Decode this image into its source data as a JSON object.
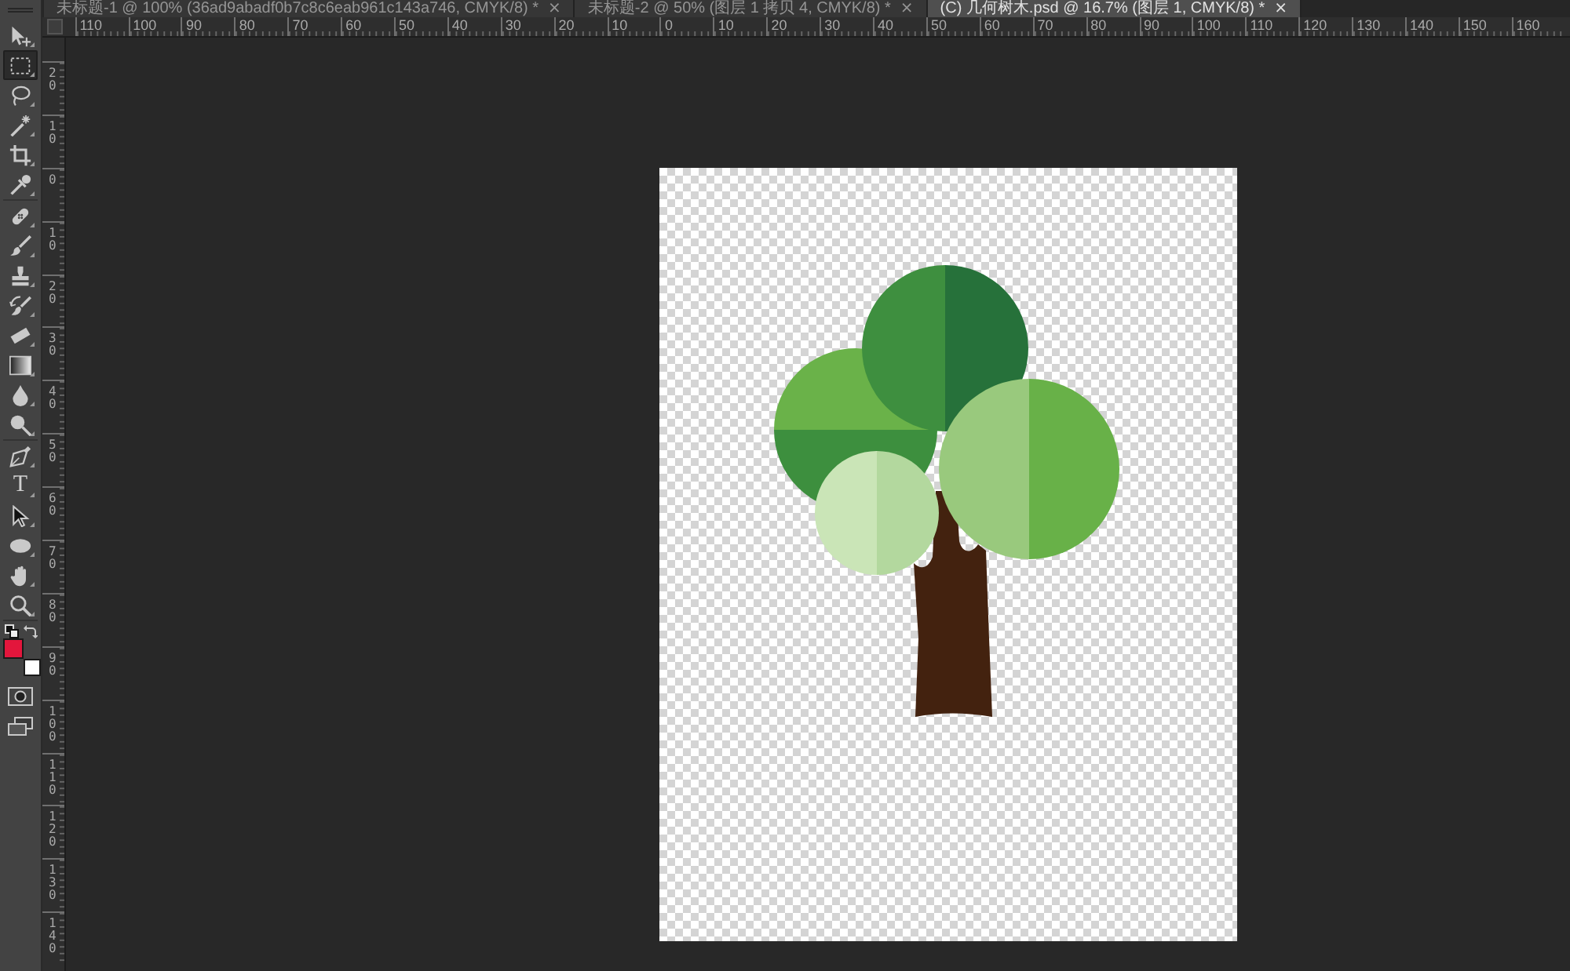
{
  "tabs": [
    {
      "label": "未标题-1 @ 100% (36ad9abadf0b7c8c6eab961c143a746, CMYK/8) *",
      "close": "×",
      "selected": false
    },
    {
      "label": "未标题-2 @ 50% (图层 1 拷贝 4, CMYK/8) *",
      "close": "×",
      "selected": false
    },
    {
      "label": "(C) 几何树木.psd @ 16.7% (图层 1, CMYK/8) *",
      "close": "×",
      "selected": true
    }
  ],
  "rulers": {
    "horizontal": [
      "110",
      "100",
      "90",
      "80",
      "70",
      "60",
      "50",
      "40",
      "30",
      "20",
      "10",
      "0",
      "10",
      "20",
      "30",
      "40",
      "50",
      "60",
      "70",
      "80",
      "90",
      "100",
      "110",
      "120",
      "130",
      "140",
      "150",
      "160"
    ],
    "vertical": [
      "20",
      "10",
      "0",
      "10",
      "20",
      "30",
      "40",
      "50",
      "60",
      "70",
      "80",
      "90",
      "100",
      "110",
      "120",
      "130",
      "140"
    ]
  },
  "tool_groups": [
    {
      "tools": [
        {
          "kind": "move",
          "selected": false
        },
        {
          "kind": "marquee",
          "selected": true
        },
        {
          "kind": "lasso",
          "selected": false
        },
        {
          "kind": "wand",
          "selected": false
        },
        {
          "kind": "crop",
          "selected": false
        },
        {
          "kind": "eyedropper",
          "selected": false
        }
      ]
    },
    {
      "tools": [
        {
          "kind": "healing",
          "selected": false
        },
        {
          "kind": "brush",
          "selected": false
        },
        {
          "kind": "stamp",
          "selected": false
        },
        {
          "kind": "history",
          "selected": false
        },
        {
          "kind": "eraser",
          "selected": false
        },
        {
          "kind": "gradient",
          "selected": false
        },
        {
          "kind": "blur",
          "selected": false
        },
        {
          "kind": "dodge",
          "selected": false
        }
      ]
    },
    {
      "tools": [
        {
          "kind": "pen",
          "selected": false
        },
        {
          "kind": "type",
          "glyph": "T",
          "selected": false
        },
        {
          "kind": "pathselect",
          "selected": false
        },
        {
          "kind": "ellipse",
          "selected": false
        },
        {
          "kind": "hand",
          "selected": false
        },
        {
          "kind": "zoom",
          "selected": false
        }
      ]
    }
  ],
  "color_swatches": [
    {
      "kind": "foreground",
      "color": "#e3163c"
    },
    {
      "kind": "background",
      "color": "#ffffff"
    }
  ]
}
